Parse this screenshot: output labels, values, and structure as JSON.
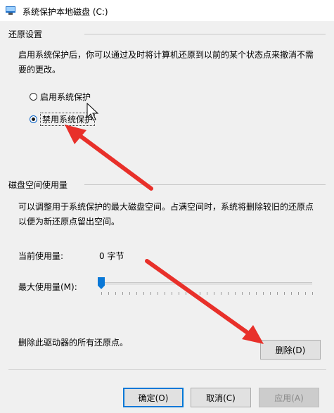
{
  "window": {
    "title": "系统保护本地磁盘 (C:)",
    "icon": "system-properties-icon"
  },
  "restore_settings": {
    "group_label": "还原设置",
    "description_line1": "启用系统保护后，你可以通过及时将计算机还原到以前的某个状态点来撤消不需",
    "description_line2": "要的更改。",
    "options": [
      {
        "label": "启用系统保护",
        "selected": false
      },
      {
        "label": "禁用系统保护",
        "selected": true
      }
    ]
  },
  "disk_usage": {
    "group_label": "磁盘空间使用量",
    "description_line1": "可以调整用于系统保护的最大磁盘空间。占满空间时，系统将删除较旧的还原点",
    "description_line2": "以便为新还原点留出空间。",
    "current_usage_label": "当前使用量:",
    "current_usage_value": "0 字节",
    "max_usage_label": "最大使用量(M):",
    "max_usage_slider_value": 0
  },
  "delete_section": {
    "label": "删除此驱动器的所有还原点。",
    "button": "删除(D)"
  },
  "buttons": {
    "ok": "确定(O)",
    "cancel": "取消(C)",
    "apply": "应用(A)"
  },
  "colors": {
    "accent": "#0078d7",
    "annotation_arrow": "#e8302a"
  }
}
